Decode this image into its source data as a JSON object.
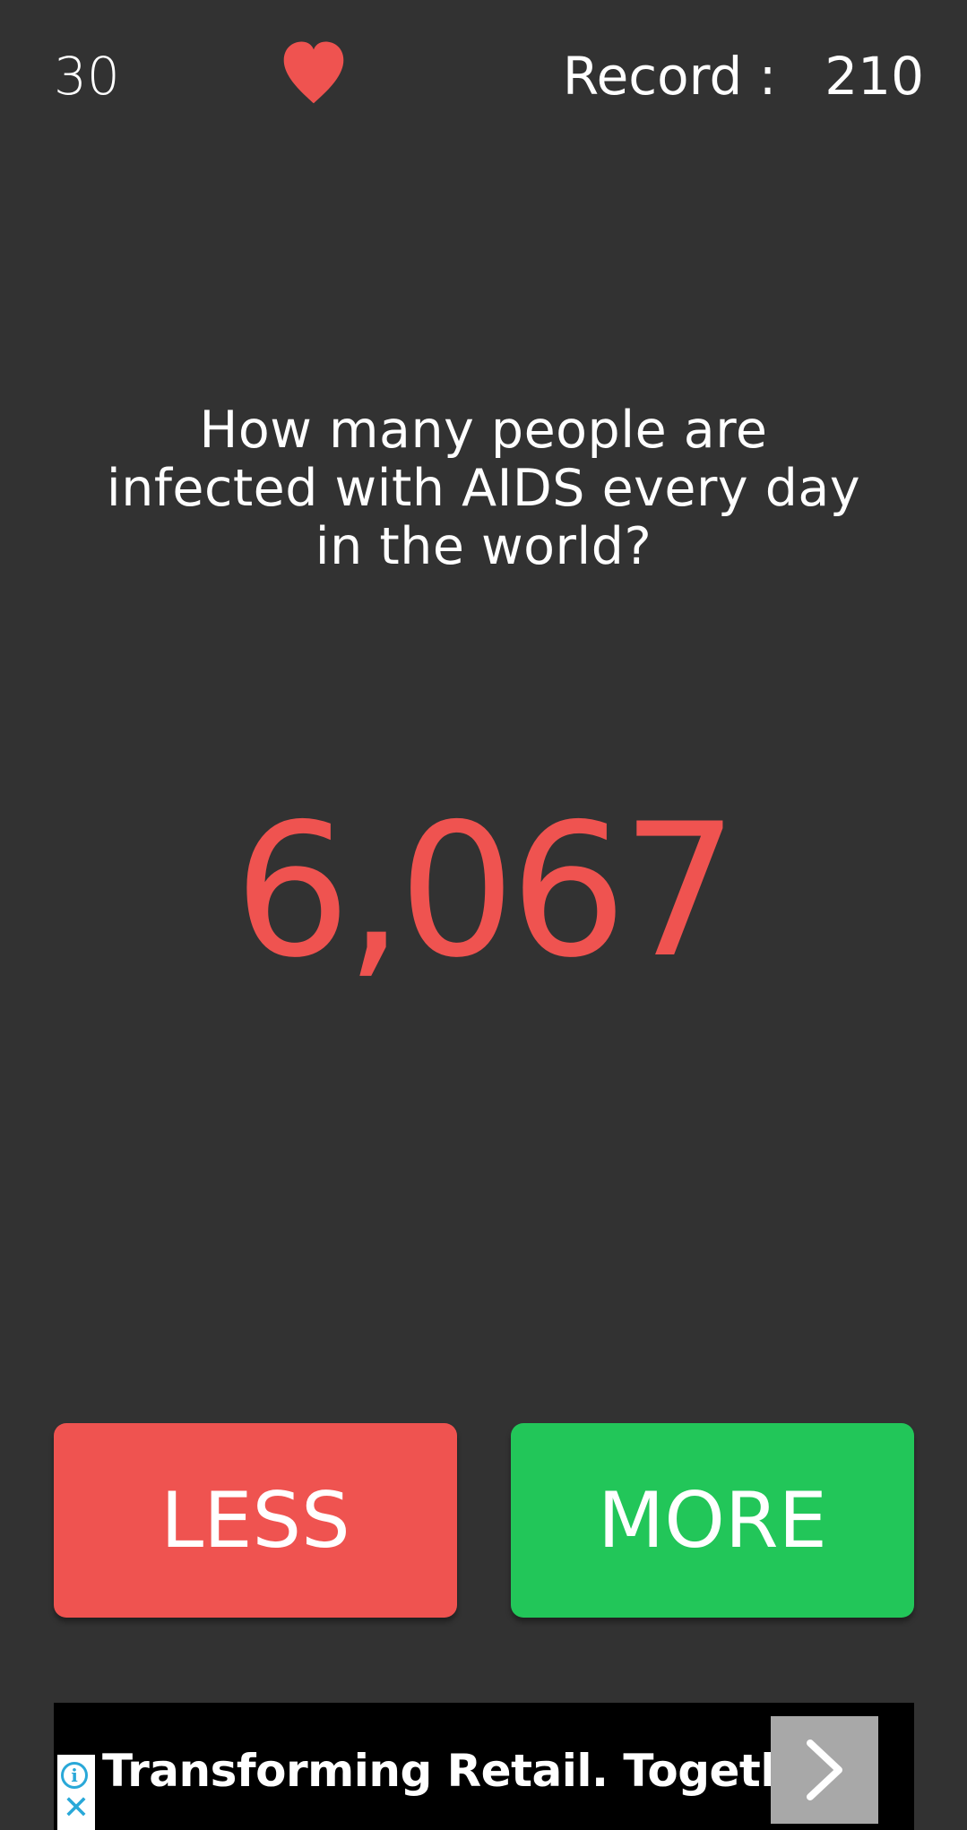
{
  "header": {
    "score": "30",
    "life_icon": "heart-icon",
    "record_label": "Record :",
    "record_value": "210"
  },
  "question": {
    "text": "How many people are infected with AIDS every day in the world?"
  },
  "answer": {
    "number": "6,067"
  },
  "buttons": {
    "less_label": "LESS",
    "more_label": "MORE"
  },
  "ad": {
    "info_icon": "info-icon",
    "close_icon": "close-icon",
    "text": "Transforming Retail. Together.",
    "arrow_icon": "chevron-right-icon"
  },
  "colors": {
    "background": "#323232",
    "accent_red": "#ef5350",
    "accent_green": "#22c659",
    "text": "#ffffff"
  }
}
